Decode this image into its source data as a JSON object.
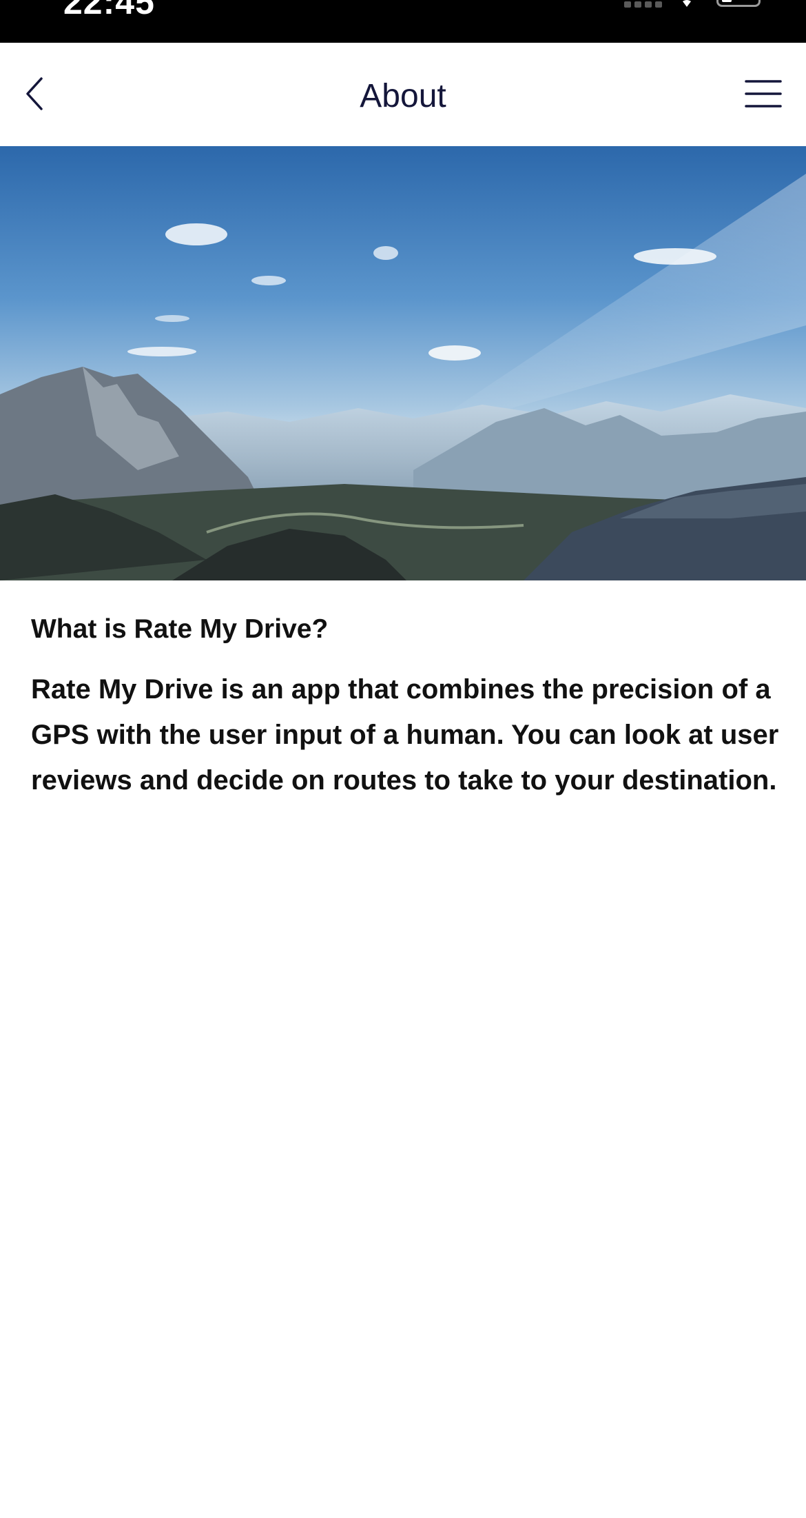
{
  "status_bar": {
    "time": "22:45"
  },
  "nav": {
    "title": "About",
    "back_icon": "chevron-left-icon",
    "menu_icon": "hamburger-menu-icon"
  },
  "hero": {
    "image": "mountain-landscape"
  },
  "about": {
    "heading": "What is Rate My Drive?",
    "body": "Rate My Drive is an app that combines the precision of a GPS with the user input of a human. You can look at user reviews and decide on routes to take to your destination."
  },
  "colors": {
    "title": "#14163a",
    "text": "#111111",
    "status_bar": "#000000"
  }
}
